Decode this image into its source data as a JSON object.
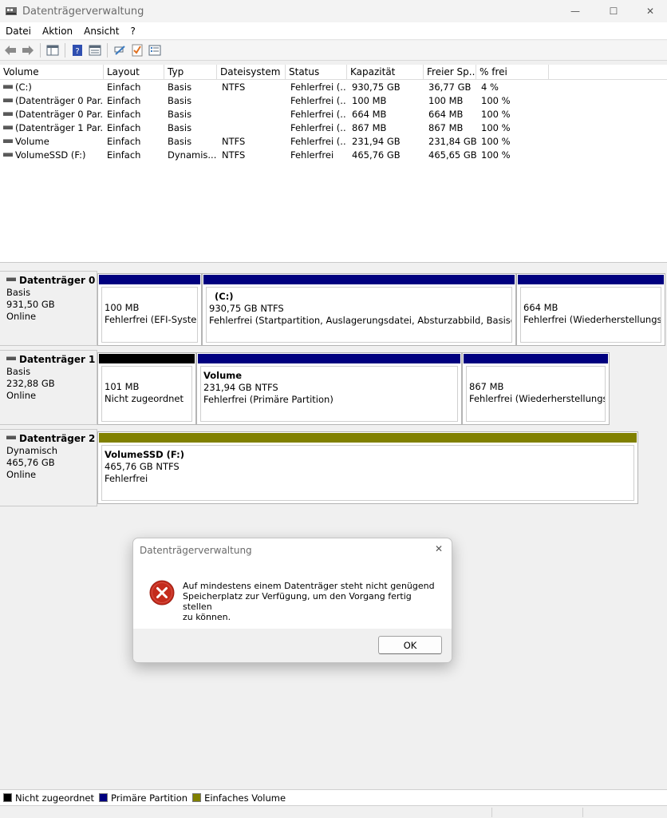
{
  "window": {
    "title": "Datenträgerverwaltung",
    "min_glyph": "—",
    "max_glyph": "☐",
    "close_glyph": "✕"
  },
  "menu": [
    "Datei",
    "Aktion",
    "Ansicht",
    "?"
  ],
  "toolbar_icons": [
    "back-arrow-icon",
    "forward-arrow-icon",
    "show-hide-console-tree-icon",
    "help-icon",
    "properties-icon",
    "connect-icon",
    "check-icon",
    "settings-list-icon"
  ],
  "table": {
    "columns": [
      "Volume",
      "Layout",
      "Typ",
      "Dateisystem",
      "Status",
      "Kapazität",
      "Freier Sp...",
      "% frei"
    ],
    "rows": [
      [
        "(C:)",
        "Einfach",
        "Basis",
        "NTFS",
        "Fehlerfrei (...",
        "930,75 GB",
        "36,77 GB",
        "4 %"
      ],
      [
        "(Datenträger 0 Par...",
        "Einfach",
        "Basis",
        "",
        "Fehlerfrei (...",
        "100 MB",
        "100 MB",
        "100 %"
      ],
      [
        "(Datenträger 0 Par...",
        "Einfach",
        "Basis",
        "",
        "Fehlerfrei (...",
        "664 MB",
        "664 MB",
        "100 %"
      ],
      [
        "(Datenträger 1 Par...",
        "Einfach",
        "Basis",
        "",
        "Fehlerfrei (...",
        "867 MB",
        "867 MB",
        "100 %"
      ],
      [
        "Volume",
        "Einfach",
        "Basis",
        "NTFS",
        "Fehlerfrei (...",
        "231,94 GB",
        "231,84 GB",
        "100 %"
      ],
      [
        "VolumeSSD (F:)",
        "Einfach",
        "Dynamis...",
        "NTFS",
        "Fehlerfrei",
        "465,76 GB",
        "465,65 GB",
        "100 %"
      ]
    ]
  },
  "disks": [
    {
      "name": "Datenträger 0",
      "kind": "Basis",
      "size": "931,50 GB",
      "state": "Online",
      "partitions": [
        {
          "name": "",
          "size": "100 MB",
          "status": "Fehlerfrei (EFI-Systempartition)"
        },
        {
          "name": "(C:)",
          "size": "930,75 GB NTFS",
          "status": "Fehlerfrei (Startpartition, Auslagerungsdatei, Absturzabbild, Basisdatenpartition)"
        },
        {
          "name": "",
          "size": "664 MB",
          "status": "Fehlerfrei (Wiederherstellungspartition)"
        }
      ]
    },
    {
      "name": "Datenträger 1",
      "kind": "Basis",
      "size": "232,88 GB",
      "state": "Online",
      "partitions": [
        {
          "name": "",
          "size": "101 MB",
          "status": "Nicht zugeordnet"
        },
        {
          "name": "Volume",
          "size": "231,94 GB NTFS",
          "status": "Fehlerfrei (Primäre Partition)"
        },
        {
          "name": "",
          "size": "867 MB",
          "status": "Fehlerfrei (Wiederherstellungspartition)"
        }
      ]
    },
    {
      "name": "Datenträger 2",
      "kind": "Dynamisch",
      "size": "465,76 GB",
      "state": "Online",
      "partitions": [
        {
          "name": "VolumeSSD  (F:)",
          "size": "465,76 GB NTFS",
          "status": "Fehlerfrei"
        }
      ]
    }
  ],
  "legend": [
    {
      "label": "Nicht zugeordnet",
      "color": "#000000"
    },
    {
      "label": "Primäre Partition",
      "color": "#00007f"
    },
    {
      "label": "Einfaches Volume",
      "color": "#808000"
    }
  ],
  "colors": {
    "primary": "#00007f",
    "unallocated": "#000000",
    "simple_volume": "#808000"
  },
  "dialog": {
    "title": "Datenträgerverwaltung",
    "icon": "error-icon",
    "message": "Auf mindestens einem Datenträger steht nicht genügend\nSpeicherplatz zur Verfügung, um den Vorgang fertig stellen\nzu können.",
    "ok_label": "OK",
    "close_glyph": "✕"
  }
}
